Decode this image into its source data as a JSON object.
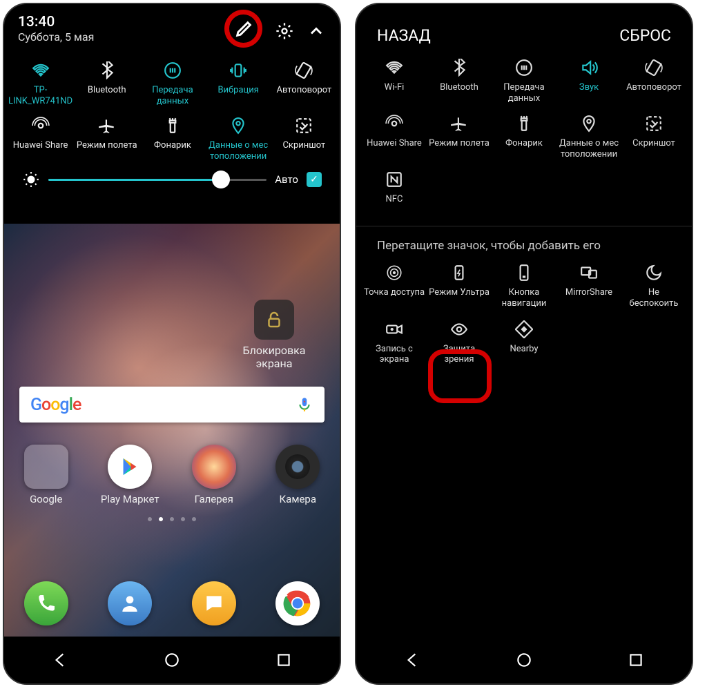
{
  "left": {
    "time": "13:40",
    "date": "Суббота, 5 мая",
    "auto_label": "Авто",
    "qs": [
      {
        "label": "TP-LINK_WR741ND",
        "active": true,
        "icon": "wifi"
      },
      {
        "label": "Bluetooth",
        "active": false,
        "icon": "bluetooth"
      },
      {
        "label": "Передача данных",
        "active": true,
        "icon": "data"
      },
      {
        "label": "Вибрация",
        "active": true,
        "icon": "vibrate"
      },
      {
        "label": "Автоповорот",
        "active": false,
        "icon": "rotate"
      },
      {
        "label": "Huawei Share",
        "active": false,
        "icon": "share"
      },
      {
        "label": "Режим полета",
        "active": false,
        "icon": "airplane"
      },
      {
        "label": "Фонарик",
        "active": false,
        "icon": "torch"
      },
      {
        "label": "Данные о мес тоположении",
        "active": true,
        "icon": "location"
      },
      {
        "label": "Скриншот",
        "active": false,
        "icon": "screenshot"
      }
    ],
    "lock_label": "Блокировка экрана",
    "apps": [
      {
        "label": "Google"
      },
      {
        "label": "Play Маркет"
      },
      {
        "label": "Галерея"
      },
      {
        "label": "Камера"
      }
    ]
  },
  "right": {
    "back": "НАЗАД",
    "reset": "СБРОС",
    "drag_hint": "Перетащите значок, чтобы добавить его",
    "qs": [
      {
        "label": "Wi-Fi",
        "icon": "wifi"
      },
      {
        "label": "Bluetooth",
        "icon": "bluetooth"
      },
      {
        "label": "Передача данных",
        "icon": "data"
      },
      {
        "label": "Звук",
        "icon": "sound",
        "active": true
      },
      {
        "label": "Автоповорот",
        "icon": "rotate"
      },
      {
        "label": "Huawei Share",
        "icon": "share"
      },
      {
        "label": "Режим полета",
        "icon": "airplane"
      },
      {
        "label": "Фонарик",
        "icon": "torch"
      },
      {
        "label": "Данные о мес тоположении",
        "icon": "location"
      },
      {
        "label": "Скриншот",
        "icon": "screenshot"
      },
      {
        "label": "NFC",
        "icon": "nfc"
      }
    ],
    "available": [
      {
        "label": "Точка доступа",
        "icon": "hotspot"
      },
      {
        "label": "Режим Ультра",
        "icon": "ultra"
      },
      {
        "label": "Кнопка навигации",
        "icon": "navbutton"
      },
      {
        "label": "MirrorShare",
        "icon": "mirror"
      },
      {
        "label": "Не беспокоить",
        "icon": "dnd"
      },
      {
        "label": "Запись с экрана",
        "icon": "record"
      },
      {
        "label": "Защита зрения",
        "icon": "eye"
      },
      {
        "label": "Nearby",
        "icon": "nearby"
      }
    ]
  }
}
